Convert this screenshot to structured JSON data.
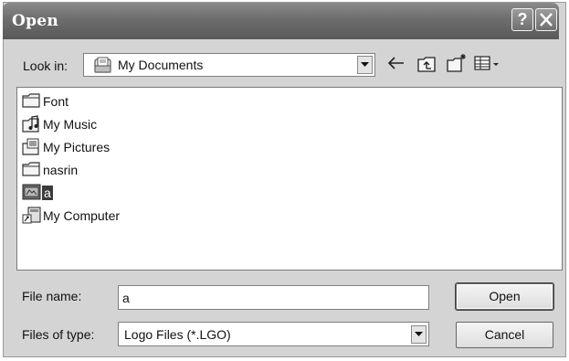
{
  "window": {
    "title": "Open",
    "help_symbol": "?"
  },
  "look_in": {
    "label": "Look in:",
    "value": "My Documents"
  },
  "toolbar": {
    "icons": [
      "back-arrow-icon",
      "up-one-level-icon",
      "create-new-folder-icon",
      "views-menu-icon"
    ]
  },
  "file_list": {
    "items": [
      {
        "label": "Font",
        "icon": "folder-icon",
        "selected": false
      },
      {
        "label": "My Music",
        "icon": "music-folder-icon",
        "selected": false
      },
      {
        "label": "My Pictures",
        "icon": "pictures-folder-icon",
        "selected": false
      },
      {
        "label": "nasrin",
        "icon": "folder-icon",
        "selected": false
      },
      {
        "label": "a",
        "icon": "logo-file-icon",
        "selected": true
      },
      {
        "label": "My Computer",
        "icon": "computer-icon",
        "selected": false
      }
    ]
  },
  "file_name": {
    "label": "File name:",
    "value": "a"
  },
  "file_type": {
    "label": "Files of type:",
    "value": "Logo Files (*.LGO)"
  },
  "buttons": {
    "open_label": "Open",
    "cancel_label": "Cancel"
  },
  "colors": {
    "titlebar": "#6d6d6d",
    "dialog_bg": "#d4d4d4",
    "selection": "#3c3c3c"
  }
}
